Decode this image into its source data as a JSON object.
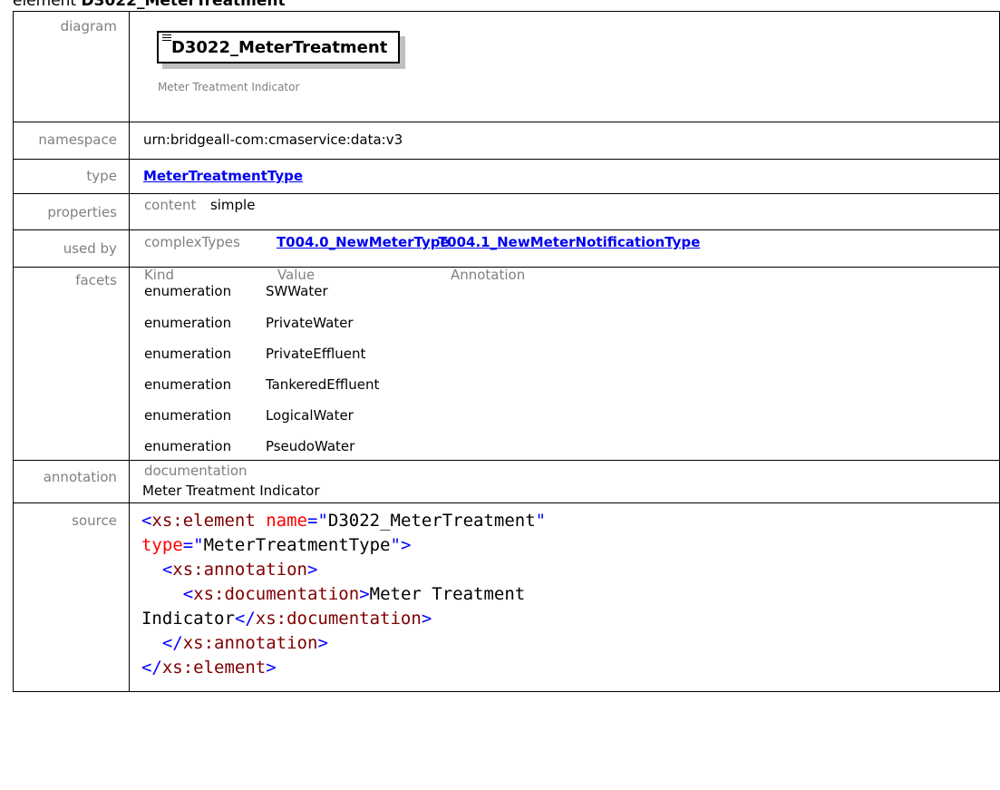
{
  "heading": {
    "prefix": "element",
    "name": "D3022_MeterTreatment"
  },
  "rows": {
    "diagram": {
      "label": "diagram",
      "box_title": "D3022_MeterTreatment",
      "caption": "Meter Treatment Indicator"
    },
    "namespace": {
      "label": "namespace",
      "value": "urn:bridgeall-com:cmaservice:data:v3"
    },
    "type": {
      "label": "type",
      "link": "MeterTreatmentType"
    },
    "properties": {
      "label": "properties",
      "key": "content",
      "value": "simple"
    },
    "used_by": {
      "label": "used by",
      "key": "complexTypes",
      "links": [
        "T004.0_NewMeterType",
        "T004.1_NewMeterNotificationType"
      ]
    },
    "facets": {
      "label": "facets",
      "headers": [
        "Kind",
        "Value",
        "Annotation"
      ],
      "items": [
        {
          "kind": "enumeration",
          "value": "SWWater"
        },
        {
          "kind": "enumeration",
          "value": "PrivateWater"
        },
        {
          "kind": "enumeration",
          "value": "PrivateEffluent"
        },
        {
          "kind": "enumeration",
          "value": "TankeredEffluent"
        },
        {
          "kind": "enumeration",
          "value": "LogicalWater"
        },
        {
          "kind": "enumeration",
          "value": "PseudoWater"
        }
      ]
    },
    "annotation": {
      "label": "annotation",
      "key": "documentation",
      "value": "Meter Treatment Indicator"
    },
    "source": {
      "label": "source",
      "element_tag": "xs:element",
      "name_attr": "name",
      "name_value": "D3022_MeterTreatment",
      "type_attr": "type",
      "type_value": "MeterTreatmentType",
      "annotation_tag": "xs:annotation",
      "documentation_tag": "xs:documentation",
      "doc_text_1": "Meter Treatment",
      "doc_text_2": "Indicator"
    }
  },
  "colors": {
    "link": "#0000ee",
    "label": "#808080",
    "tag": "#800000",
    "attr_name": "#ff0000",
    "attr_value": "#0000ff"
  }
}
